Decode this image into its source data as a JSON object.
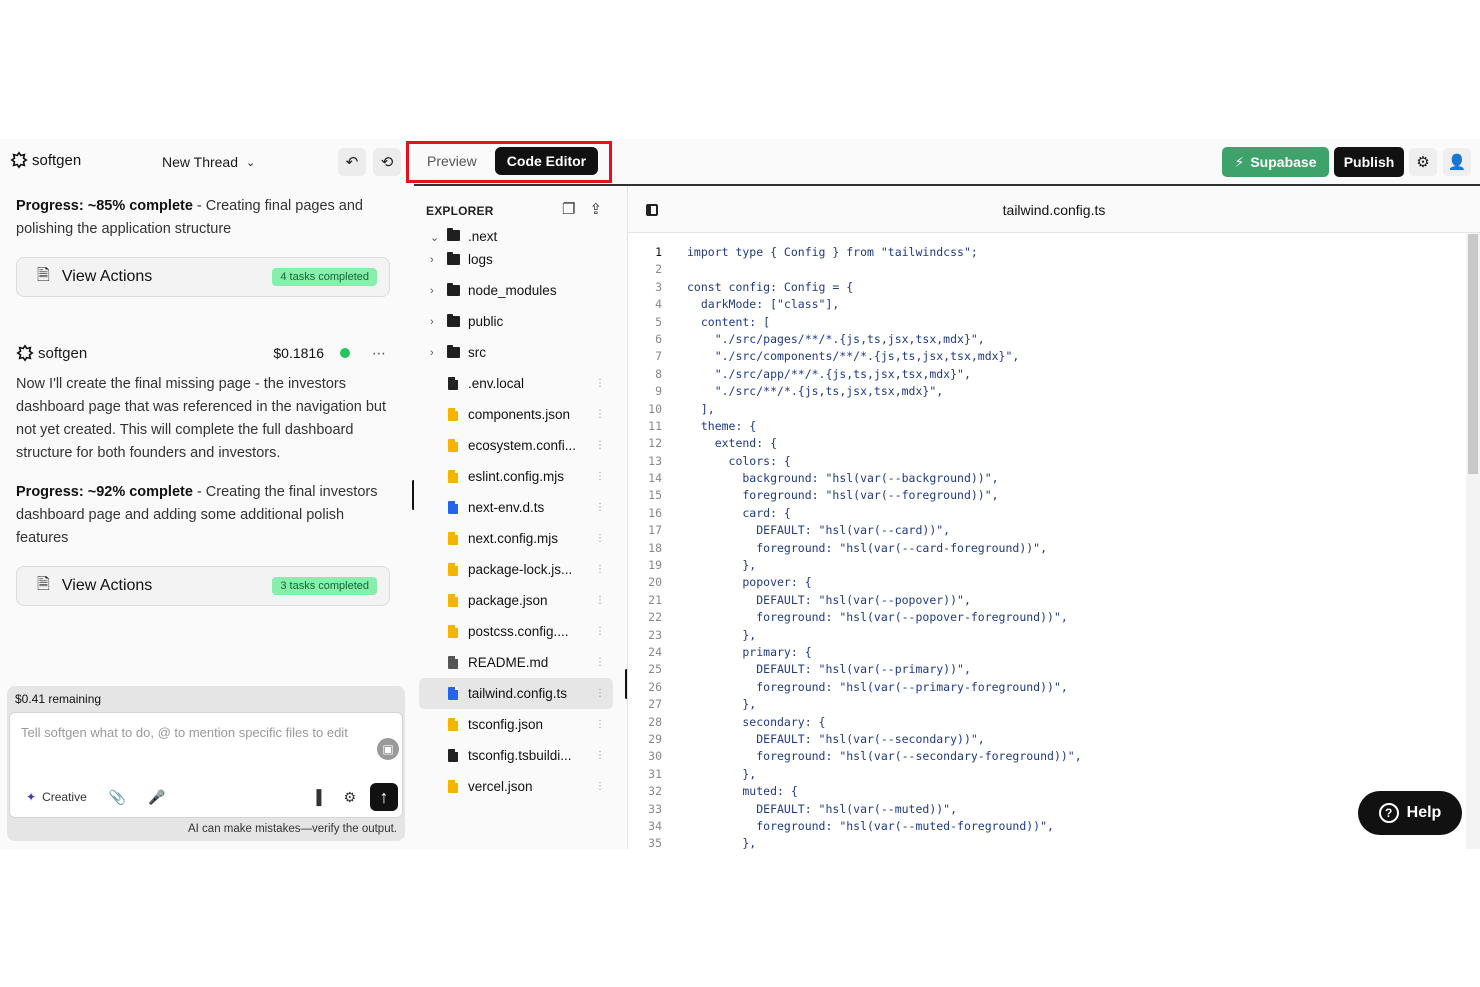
{
  "header": {
    "brand": "softgen",
    "thread_label": "New Thread",
    "tabs": [
      {
        "label": "Preview",
        "active": false
      },
      {
        "label": "Code Editor",
        "active": true
      }
    ],
    "supabase_label": "Supabase",
    "publish_label": "Publish"
  },
  "chat": {
    "progress1": {
      "bold": "Progress: ~85% complete",
      "rest": " - Creating final pages and polishing the application structure"
    },
    "card1": {
      "label": "View Actions",
      "badge": "4 tasks completed"
    },
    "message": {
      "author": "softgen",
      "cost": "$0.1816",
      "text": "Now I'll create the final missing page - the investors dashboard page that was referenced in the navigation but not yet created. This will complete the full dashboard structure for both founders and investors."
    },
    "progress2": {
      "bold": "Progress: ~92% complete",
      "rest": " - Creating the final investors dashboard page and adding some additional polish features"
    },
    "card2": {
      "label": "View Actions",
      "badge": "3 tasks completed"
    },
    "composer": {
      "remaining": "$0.41 remaining",
      "placeholder": "Tell softgen what to do, @ to mention specific files to edit",
      "mode": "Creative",
      "disclaimer": "AI can make mistakes—verify the output."
    }
  },
  "explorer": {
    "title": "EXPLORER",
    "partial_item": ".next",
    "items": [
      {
        "name": "logs",
        "type": "folder"
      },
      {
        "name": "node_modules",
        "type": "folder"
      },
      {
        "name": "public",
        "type": "folder"
      },
      {
        "name": "src",
        "type": "folder"
      },
      {
        "name": ".env.local",
        "type": "file",
        "color": "#222222"
      },
      {
        "name": "components.json",
        "type": "file",
        "color": "#f5b400"
      },
      {
        "name": "ecosystem.confi...",
        "type": "file",
        "color": "#f5b400"
      },
      {
        "name": "eslint.config.mjs",
        "type": "file",
        "color": "#f5b400"
      },
      {
        "name": "next-env.d.ts",
        "type": "file",
        "color": "#2563eb"
      },
      {
        "name": "next.config.mjs",
        "type": "file",
        "color": "#f5b400"
      },
      {
        "name": "package-lock.js...",
        "type": "file",
        "color": "#f5b400"
      },
      {
        "name": "package.json",
        "type": "file",
        "color": "#f5b400"
      },
      {
        "name": "postcss.config....",
        "type": "file",
        "color": "#f5b400"
      },
      {
        "name": "README.md",
        "type": "file",
        "color": "#555555"
      },
      {
        "name": "tailwind.config.ts",
        "type": "file",
        "color": "#2563eb",
        "selected": true
      },
      {
        "name": "tsconfig.json",
        "type": "file",
        "color": "#f5b400"
      },
      {
        "name": "tsconfig.tsbuildi...",
        "type": "file",
        "color": "#222222"
      },
      {
        "name": "vercel.json",
        "type": "file",
        "color": "#f5b400"
      }
    ]
  },
  "editor": {
    "filename": "tailwind.config.ts",
    "lines": [
      "import type { Config } from \"tailwindcss\";",
      "",
      "const config: Config = {",
      "  darkMode: [\"class\"],",
      "  content: [",
      "    \"./src/pages/**/*.{js,ts,jsx,tsx,mdx}\",",
      "    \"./src/components/**/*.{js,ts,jsx,tsx,mdx}\",",
      "    \"./src/app/**/*.{js,ts,jsx,tsx,mdx}\",",
      "    \"./src/**/*.{js,ts,jsx,tsx,mdx}\",",
      "  ],",
      "  theme: {",
      "    extend: {",
      "      colors: {",
      "        background: \"hsl(var(--background))\",",
      "        foreground: \"hsl(var(--foreground))\",",
      "        card: {",
      "          DEFAULT: \"hsl(var(--card))\",",
      "          foreground: \"hsl(var(--card-foreground))\",",
      "        },",
      "        popover: {",
      "          DEFAULT: \"hsl(var(--popover))\",",
      "          foreground: \"hsl(var(--popover-foreground))\",",
      "        },",
      "        primary: {",
      "          DEFAULT: \"hsl(var(--primary))\",",
      "          foreground: \"hsl(var(--primary-foreground))\",",
      "        },",
      "        secondary: {",
      "          DEFAULT: \"hsl(var(--secondary))\",",
      "          foreground: \"hsl(var(--secondary-foreground))\",",
      "        },",
      "        muted: {",
      "          DEFAULT: \"hsl(var(--muted))\",",
      "          foreground: \"hsl(var(--muted-foreground))\",",
      "        },"
    ]
  },
  "help_label": "Help",
  "colors": {
    "accent_green": "#3ea36b",
    "highlight_red": "#e8101a",
    "badge_green": "#86efac"
  }
}
